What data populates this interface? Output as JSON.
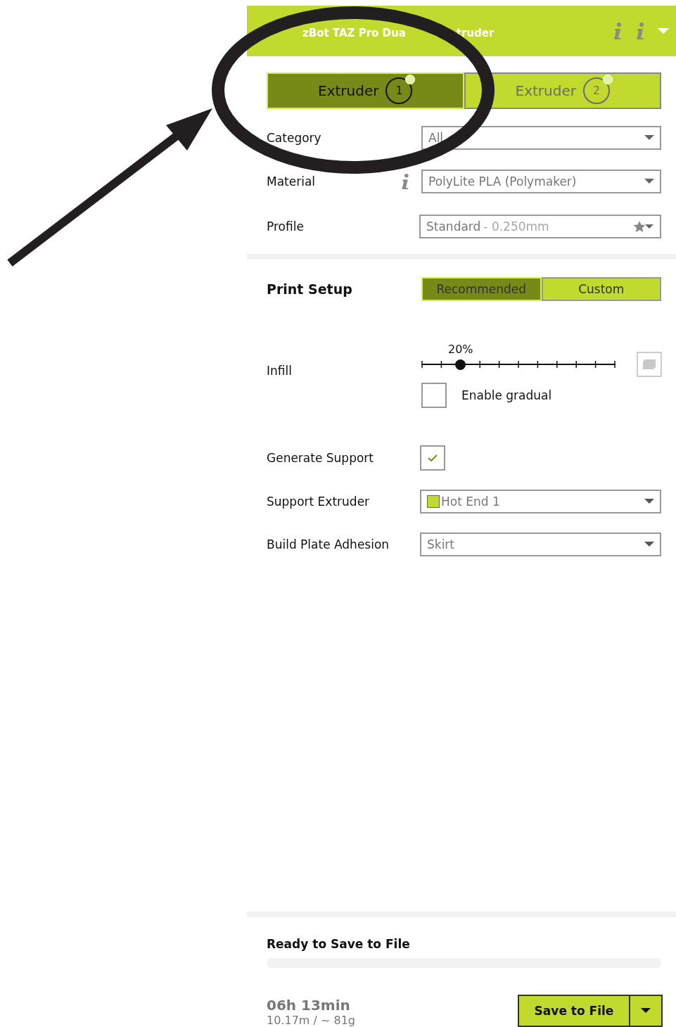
{
  "header": {
    "title_parts": [
      "zBot TAZ Pro Dua",
      "truder"
    ]
  },
  "extruder_tabs": [
    {
      "label": "Extruder",
      "number": "1",
      "selected": true
    },
    {
      "label": "Extruder",
      "number": "2",
      "selected": false
    }
  ],
  "material_rows": [
    {
      "label": "Category",
      "value": "All",
      "kind": "dropdown"
    },
    {
      "label": "Material",
      "value": "PolyLite PLA (Polymaker)",
      "kind": "dropdown-info"
    },
    {
      "label": "Profile",
      "value": "Standard",
      "detail": "- 0.250mm",
      "kind": "profile"
    }
  ],
  "print_setup": {
    "title": "Print Setup",
    "modes": [
      {
        "label": "Recommended",
        "selected": true
      },
      {
        "label": "Custom",
        "selected": false
      }
    ]
  },
  "infill": {
    "label": "Infill",
    "reading": "20%",
    "level": 0.2,
    "gradual": {
      "label": "Enable gradual",
      "checked": false
    }
  },
  "support": {
    "label": "Generate Support",
    "checked": true
  },
  "support_extruder": {
    "label": "Support Extruder",
    "value": "Hot End 1",
    "color": "#c2d92e"
  },
  "adhesion": {
    "label": "Build Plate Adhesion",
    "value": "Skirt"
  },
  "footer": {
    "status": "Ready to Save to File",
    "level": 0,
    "time": "06h 13min",
    "stats": "10.17m / ~ 81g",
    "button": "Save to File"
  }
}
